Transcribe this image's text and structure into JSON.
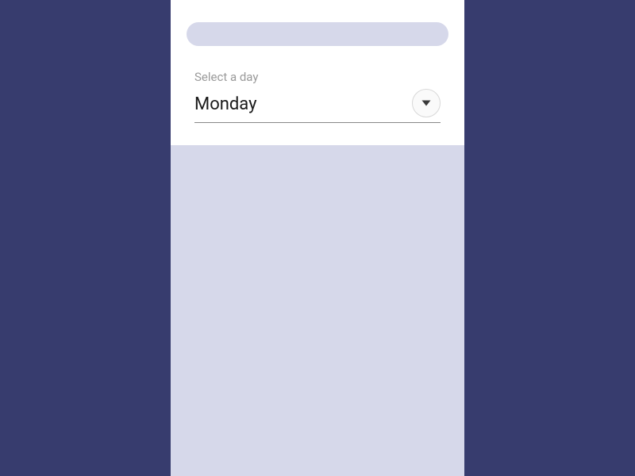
{
  "select": {
    "label": "Select a day",
    "value": "Monday"
  },
  "colors": {
    "background": "#373c6e",
    "muted": "#d6d8ea"
  }
}
